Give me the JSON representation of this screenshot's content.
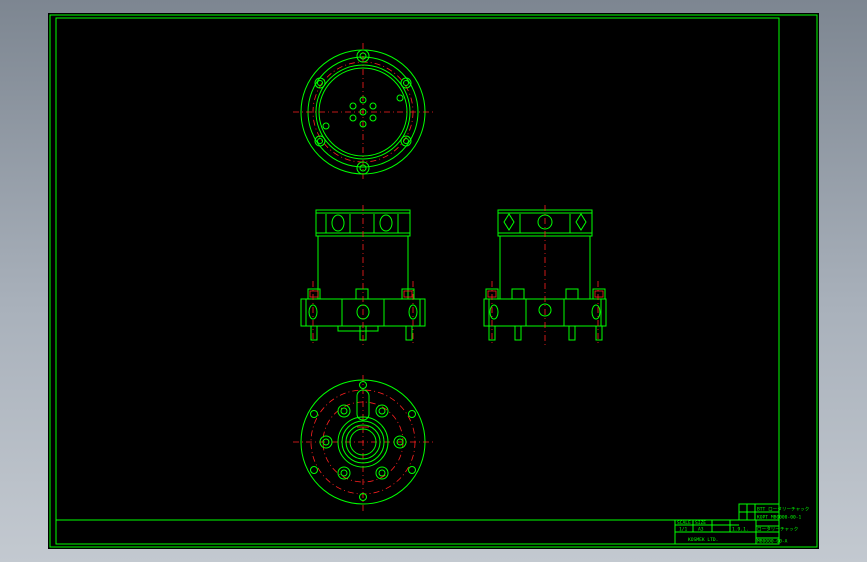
{
  "colors": {
    "background": "#000000",
    "line": "#00ff00",
    "center_line": "#ff2020",
    "outer": "#a9b1bb"
  },
  "title_block": {
    "row1": "BTT ロータリーチャック",
    "row2": "KOPT MB0000-00-1",
    "scale_header": "SCALE",
    "scale_value": "1/1",
    "size_header": "SIZE",
    "size_value": "A3",
    "date_value": "1.9.1.",
    "drawing_title": "ロータリーチャック",
    "drawing_no": "MB0000-00-A",
    "company": "KOSMEK LTD."
  }
}
